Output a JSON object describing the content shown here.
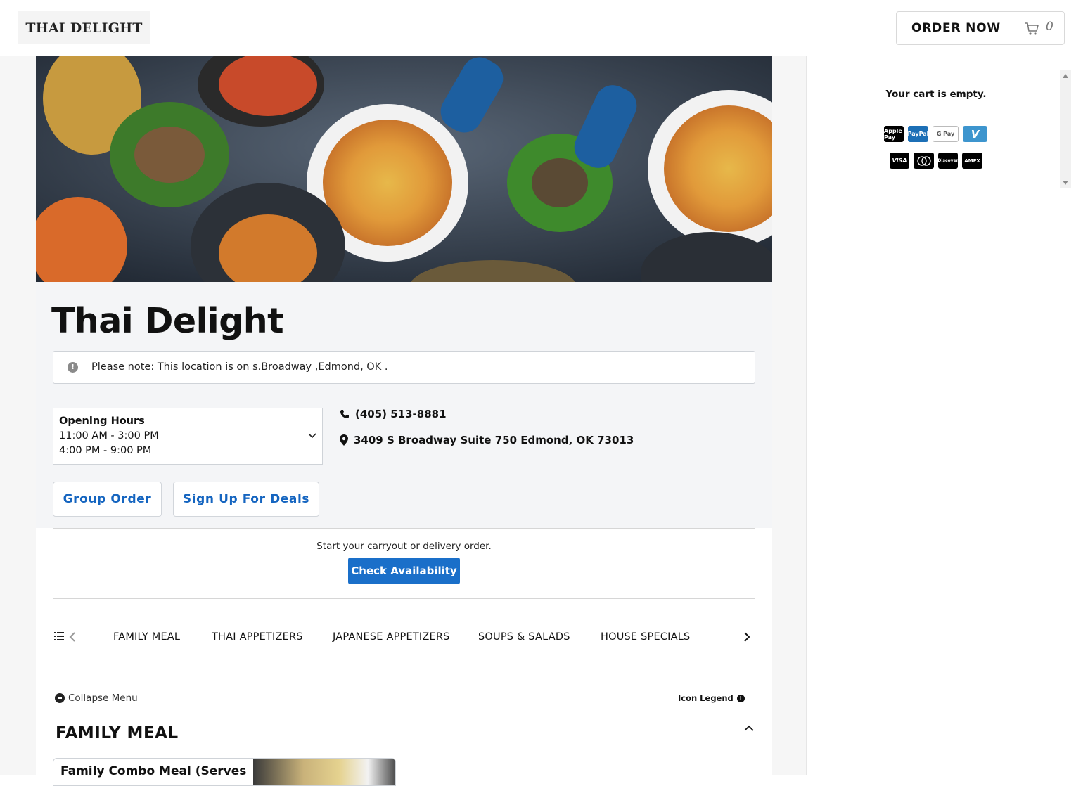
{
  "header": {
    "logo_text": "THAI DELIGHT",
    "order_now_label": "ORDER NOW",
    "cart_count": "0"
  },
  "cart": {
    "empty_text": "Your cart is empty.",
    "payment_methods_row1": [
      "Apple Pay",
      "PayPal",
      "G Pay",
      "V"
    ],
    "payment_methods_row2": [
      "VISA",
      "Mastercard",
      "Discover",
      "AMEX"
    ]
  },
  "restaurant": {
    "name": "Thai Delight",
    "notice": "Please note: This location is on s.Broadway ,Edmond, OK .",
    "hours_title": "Opening Hours",
    "hours": [
      "11:00 AM - 3:00 PM",
      "4:00 PM - 9:00 PM"
    ],
    "phone": "(405) 513-8881",
    "address": "3409 S Broadway Suite 750 Edmond, OK 73013"
  },
  "actions": {
    "group_order": "Group Order",
    "sign_up": "Sign Up For Deals",
    "start_text": "Start your carryout or delivery order.",
    "check_availability": "Check Availability"
  },
  "categories": [
    "FAMILY MEAL",
    "THAI APPETIZERS",
    "JAPANESE APPETIZERS",
    "SOUPS & SALADS",
    "HOUSE SPECIALS"
  ],
  "menu": {
    "collapse_label": "Collapse Menu",
    "legend_label": "Icon Legend",
    "section_title": "FAMILY MEAL",
    "first_item": "Family Combo Meal (Serves"
  },
  "colors": {
    "accent": "#1a6fc9",
    "link": "#1565c0",
    "info_bg": "#f4f5f7"
  }
}
